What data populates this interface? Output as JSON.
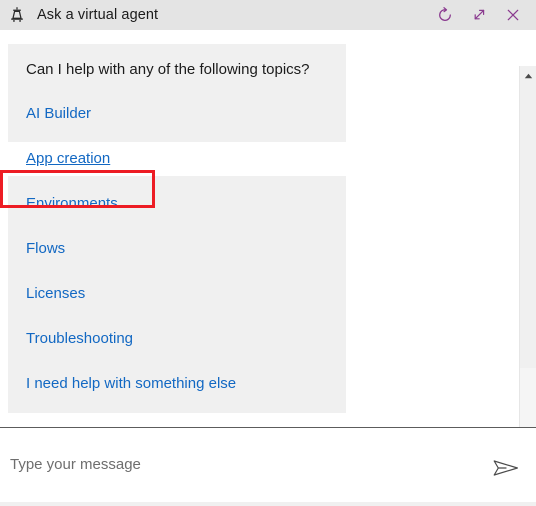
{
  "window": {
    "title": "Ask a virtual agent",
    "agent_icon": "robot-agent-icon",
    "actions": [
      {
        "name": "refresh",
        "icon": "refresh-icon",
        "label": "Refresh"
      },
      {
        "name": "minimize",
        "icon": "collapse-diagonal-icon",
        "label": "Minimize"
      },
      {
        "name": "close",
        "icon": "close-icon",
        "label": "Close"
      }
    ]
  },
  "conversation": {
    "message": {
      "prompt": "Can I help with any of the following topics?",
      "topics": [
        {
          "label": "AI Builder",
          "hovered": false
        },
        {
          "label": "App creation",
          "hovered": true
        },
        {
          "label": "Environments",
          "hovered": false
        },
        {
          "label": "Flows",
          "hovered": false
        },
        {
          "label": "Licenses",
          "hovered": false
        },
        {
          "label": "Troubleshooting",
          "hovered": false
        },
        {
          "label": "I need help with something else",
          "hovered": false
        }
      ]
    }
  },
  "scrollbar": {
    "up_arrow_icon": "triangle-up-icon",
    "down_arrow_icon": "triangle-down-icon"
  },
  "composer": {
    "placeholder": "Type your message",
    "value": "",
    "send_icon": "send-paper-plane-icon"
  },
  "annotation": {
    "target": "App creation",
    "shape": "rectangle",
    "color": "#ed1c24"
  },
  "colors": {
    "titlebar_bg": "#e4e4e4",
    "titlebar_icon": "#8a3a8f",
    "bubble_bg": "#f0f0f0",
    "link": "#1268c3",
    "text": "#1b1b1b",
    "placeholder": "#6e6e6e",
    "annotation_red": "#ed1c24"
  }
}
